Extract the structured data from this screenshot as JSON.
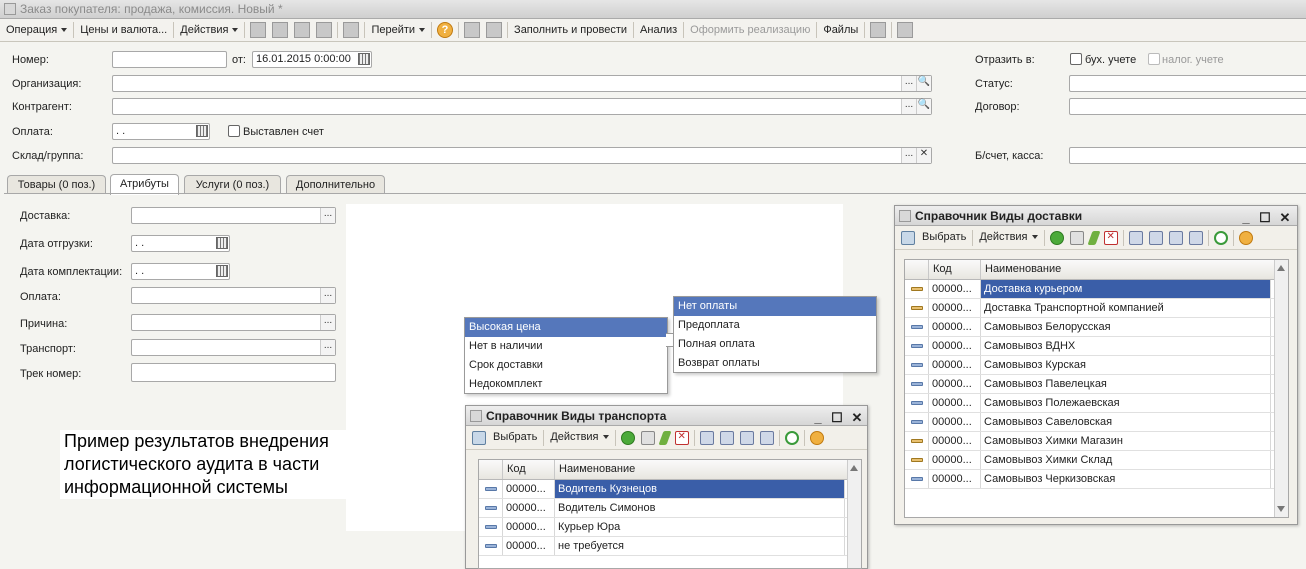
{
  "window": {
    "title": "Заказ покупателя: продажа, комиссия. Новый *"
  },
  "toolbar": {
    "operation": "Операция",
    "prices": "Цены и валюта...",
    "actions": "Действия",
    "goto": "Перейти",
    "fill_post": "Заполнить и провести",
    "analysis": "Анализ",
    "make_sale": "Оформить реализацию",
    "files": "Файлы",
    "help": "?"
  },
  "header": {
    "number_label": "Номер:",
    "number_value": "",
    "from_label": "от:",
    "date_value": "16.01.2015  0:00:00",
    "org_label": "Организация:",
    "contractor_label": "Контрагент:",
    "payment_label": "Оплата:",
    "payment_value": " .  .",
    "invoice_label": "Выставлен счет",
    "warehouse_label": "Склад/группа:",
    "reflect_label": "Отразить в:",
    "acc_label": "бух. учете",
    "tax_label": "налог. учете",
    "status_label": "Статус:",
    "contract_label": "Договор:",
    "bank_label": "Б/счет, касса:"
  },
  "tabs": [
    "Товары (0 поз.)",
    "Атрибуты",
    "Услуги (0 поз.)",
    "Дополнительно"
  ],
  "attributes": {
    "delivery": "Доставка:",
    "ship_date": "Дата отгрузки:",
    "pack_date": "Дата комплектации:",
    "payment": "Оплата:",
    "reason": "Причина:",
    "transport": "Транспорт:",
    "track": "Трек номер:",
    "date_placeholder": " .  ."
  },
  "caption": "Пример результатов внедрения логистического аудита в части информационной системы",
  "reason_menu": [
    "Высокая цена",
    "Нет в наличии",
    "Срок доставки",
    "Недокомплект"
  ],
  "payment_menu": [
    "Нет оплаты",
    "Предоплата",
    "Полная оплата",
    "Возврат оплаты"
  ],
  "delivery_dir": {
    "title": "Справочник Виды доставки",
    "select": "Выбрать",
    "actions": "Действия",
    "col_code": "Код",
    "col_name": "Наименование",
    "rows": [
      {
        "code": "00000...",
        "name": "Доставка курьером"
      },
      {
        "code": "00000...",
        "name": "Доставка Транспортной компанией"
      },
      {
        "code": "00000...",
        "name": "Самовывоз Белорусская"
      },
      {
        "code": "00000...",
        "name": "Самовывоз ВДНХ"
      },
      {
        "code": "00000...",
        "name": "Самовывоз Курская"
      },
      {
        "code": "00000...",
        "name": "Самовывоз Павелецкая"
      },
      {
        "code": "00000...",
        "name": "Самовывоз Полежаевская"
      },
      {
        "code": "00000...",
        "name": "Самовывоз Савеловская"
      },
      {
        "code": "00000...",
        "name": "Самовывоз Химки Магазин"
      },
      {
        "code": "00000...",
        "name": "Самовывоз Химки Склад"
      },
      {
        "code": "00000...",
        "name": "Самовывоз Черкизовская"
      }
    ]
  },
  "transport_dir": {
    "title": "Справочник Виды транспорта",
    "select": "Выбрать",
    "actions": "Действия",
    "col_code": "Код",
    "col_name": "Наименование",
    "rows": [
      {
        "code": "00000...",
        "name": "Водитель Кузнецов"
      },
      {
        "code": "00000...",
        "name": "Водитель Симонов"
      },
      {
        "code": "00000...",
        "name": "Курьер Юра"
      },
      {
        "code": "00000...",
        "name": "не требуется"
      }
    ]
  }
}
